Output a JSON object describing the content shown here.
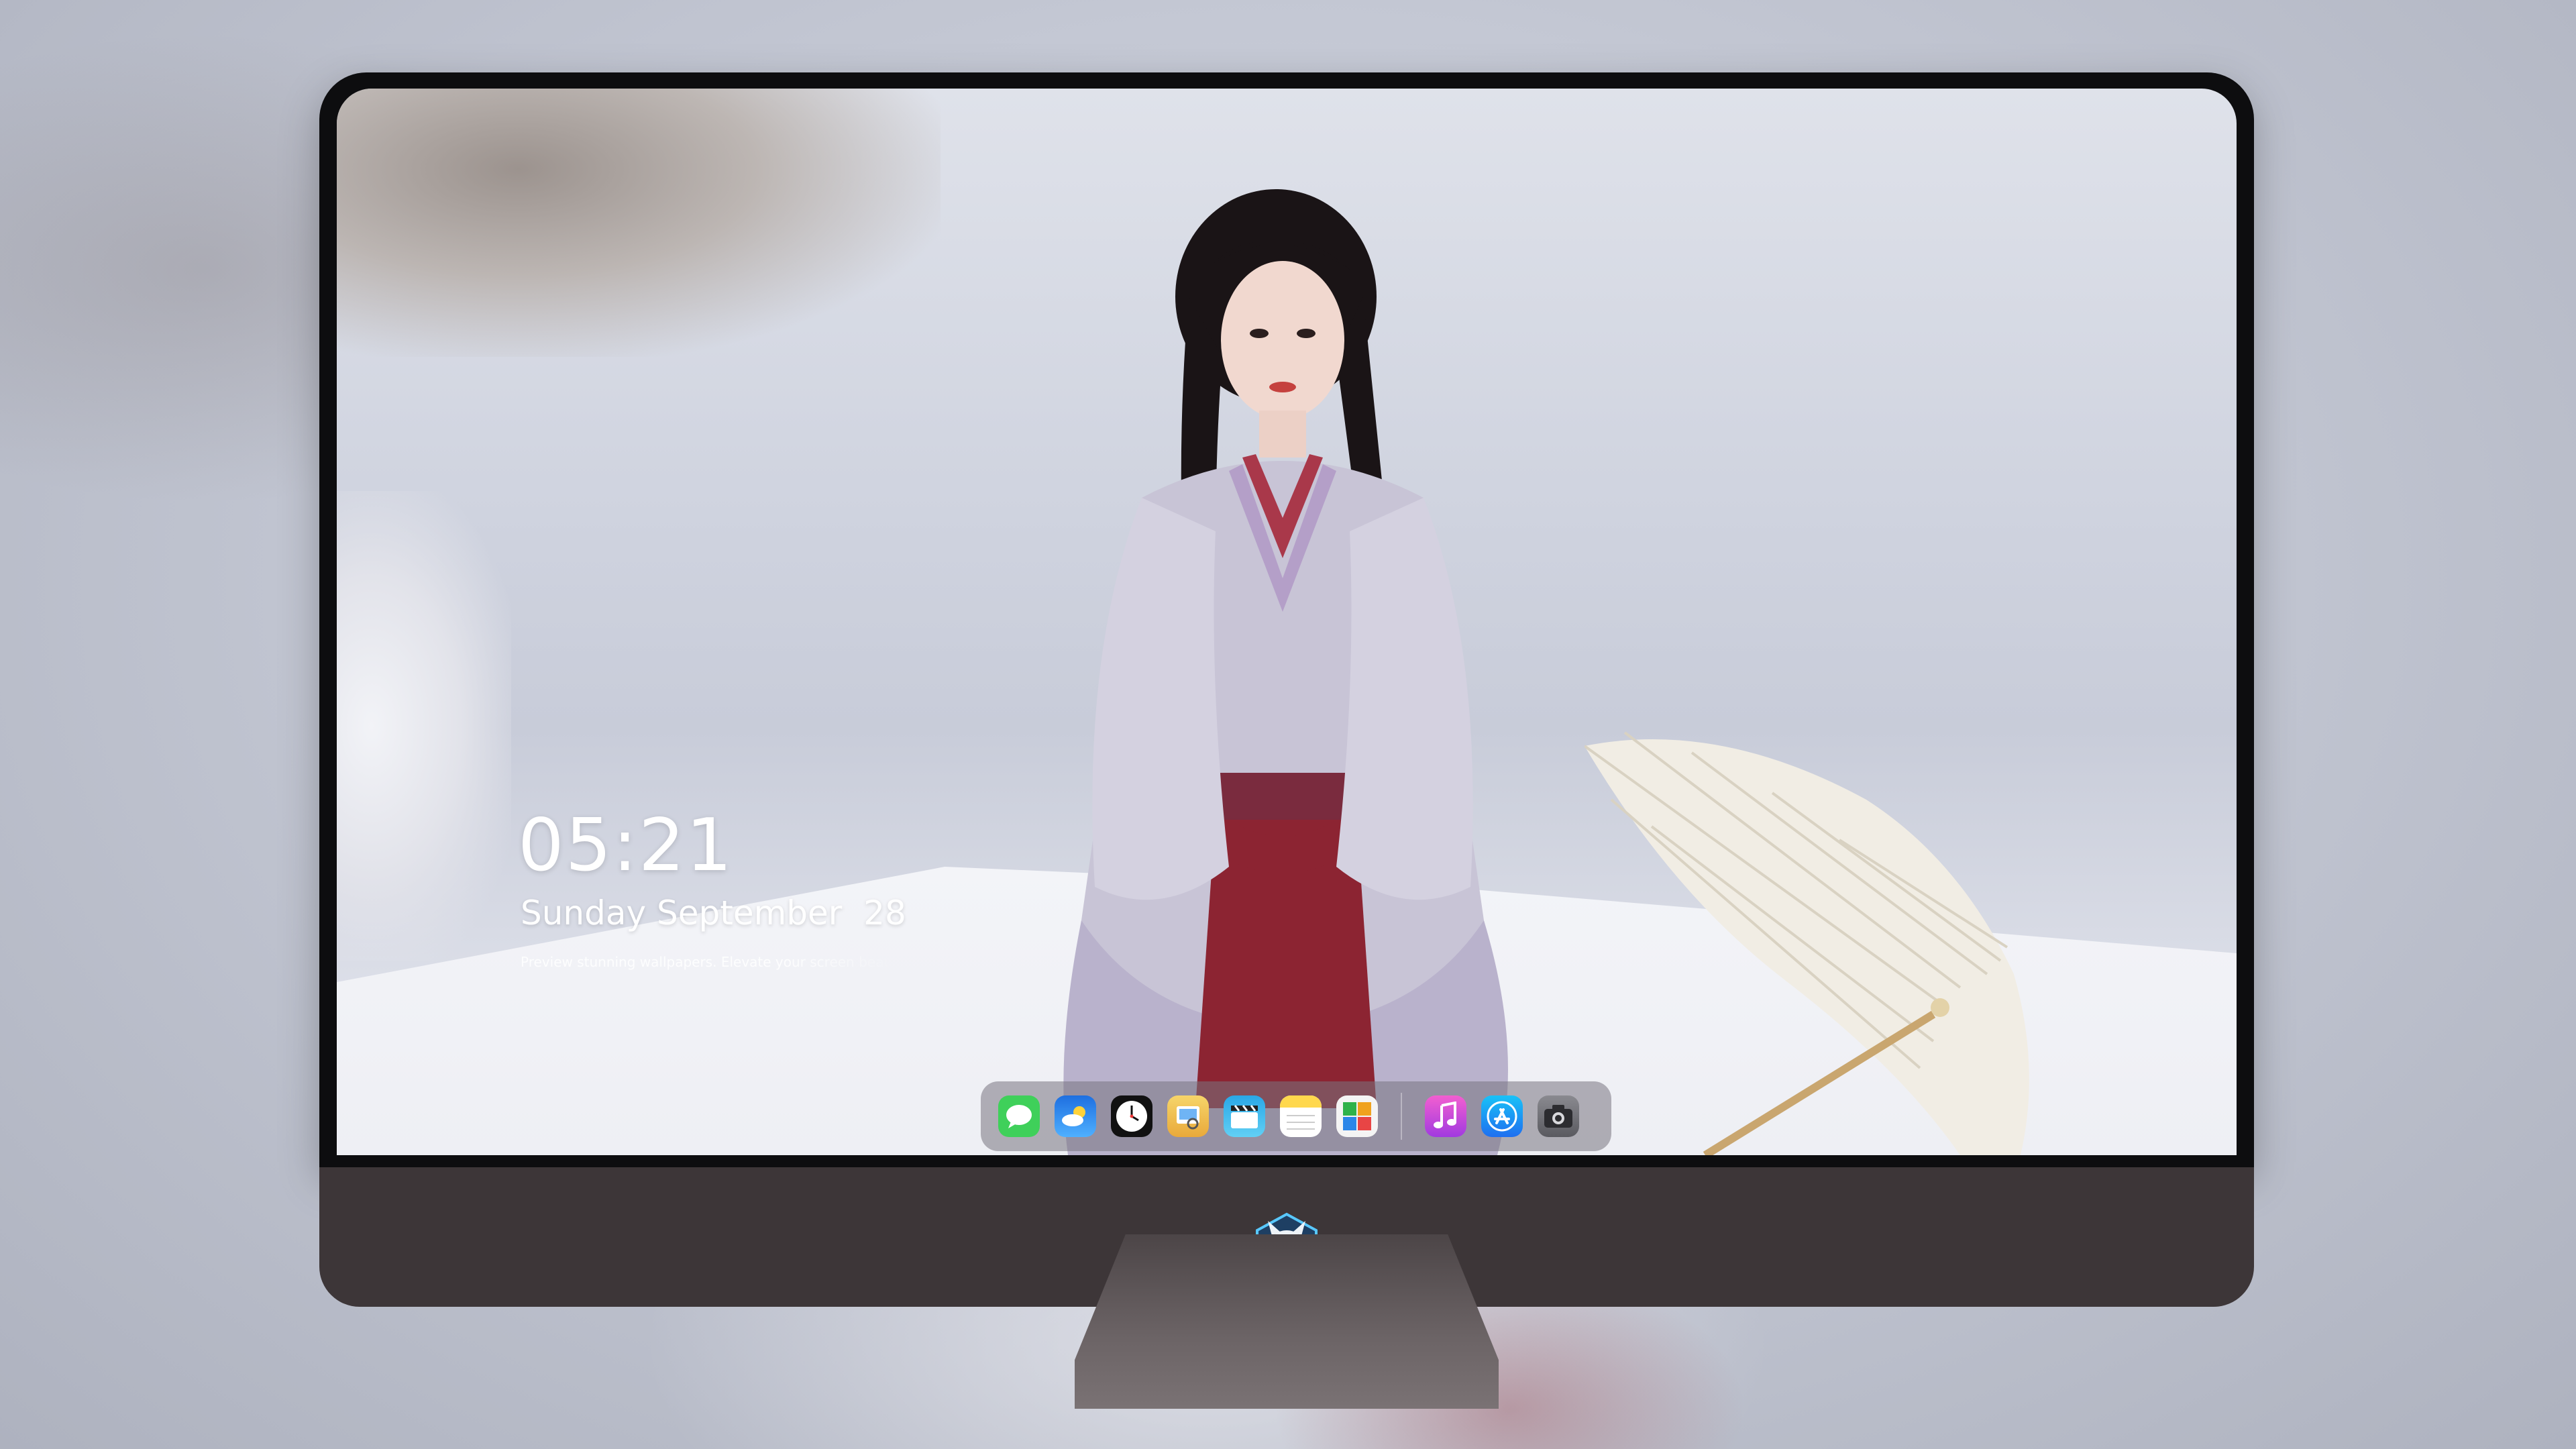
{
  "lock_screen": {
    "time": "05:21",
    "date": "Sunday September  28",
    "tagline": "Preview stunning wallpapers. Elevate your screen beauty"
  },
  "dock": {
    "apps": [
      {
        "name": "messages-icon",
        "color": "#3fd05a"
      },
      {
        "name": "weather-icon",
        "color": "#2f8df5"
      },
      {
        "name": "clock-icon",
        "color": "#111111"
      },
      {
        "name": "preview-icon",
        "color": "#f3c23a"
      },
      {
        "name": "clips-icon",
        "color": "#36b6e8"
      },
      {
        "name": "notes-icon",
        "color": "#ffd84d"
      },
      {
        "name": "calendar-icon",
        "color": "#f4f4f4"
      },
      {
        "name": "music-icon",
        "color": "#e03ad6"
      },
      {
        "name": "app-store-icon",
        "color": "#1e8bf6"
      },
      {
        "name": "camera-icon",
        "color": "#6c6c70"
      }
    ]
  },
  "colors": {
    "bezel": "#0d0d0f",
    "chin": "#3d3638",
    "dock_bg": "rgba(120,116,128,0.55)",
    "text": "#ffffff"
  }
}
